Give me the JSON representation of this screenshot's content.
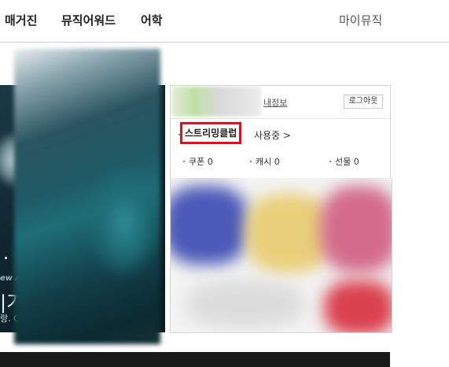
{
  "nav": {
    "magazine": "매거진",
    "keyword": "뮤직어워드",
    "lang": "어학",
    "mymusic": "마이뮤직"
  },
  "banner": {
    "sub": "ew A",
    "title": "|기",
    "desc": "랑. C"
  },
  "user": {
    "myinfo_label": "내정보",
    "logout_label": "로그아웃"
  },
  "club": {
    "name": "스트리밍클럽",
    "status": "사용중 >"
  },
  "stats": {
    "coupon": "쿠폰 0",
    "cash": "캐시 0",
    "gift": "선물 0"
  },
  "colors": {
    "highlight": "#e0101e",
    "nav_text": "#222222"
  }
}
